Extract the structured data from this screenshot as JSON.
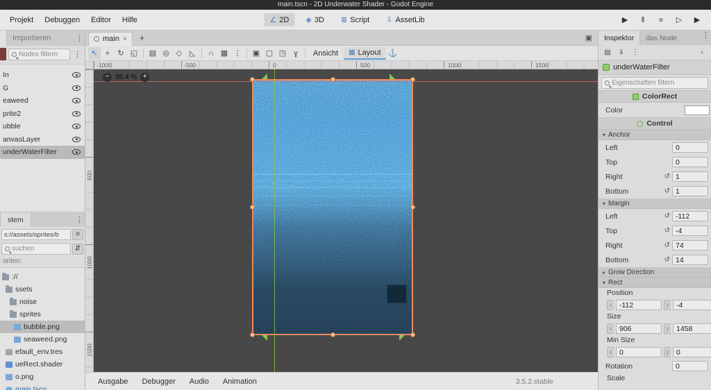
{
  "window": {
    "title": "main.tscn - 2D Underwater Shader - Godot Engine"
  },
  "menubar": {
    "menus": [
      "Projekt",
      "Debuggen",
      "Editor",
      "Hilfe"
    ],
    "workspaces": [
      "2D",
      "3D",
      "Script",
      "AssetLib"
    ]
  },
  "scene_dock": {
    "import_tab": "Importieren",
    "filter_placeholder": "Nodes filtern",
    "nodes": [
      {
        "label": "In"
      },
      {
        "label": "G"
      },
      {
        "label": "eaweed"
      },
      {
        "label": "prite2"
      },
      {
        "label": "ubble"
      },
      {
        "label": "anvasLayer"
      },
      {
        "label": "underWaterFilter"
      }
    ]
  },
  "filesystem_dock": {
    "tab": "stem",
    "path": "s://assets/sprites/b",
    "search_placeholder": "suchen",
    "favorites_label": "oriten:",
    "items": [
      {
        "label": "://"
      },
      {
        "label": "ssets"
      },
      {
        "label": "noise"
      },
      {
        "label": "sprites"
      },
      {
        "label": "bubble.png"
      },
      {
        "label": "seaweed.png"
      },
      {
        "label": "efault_env.tres"
      },
      {
        "label": "ueRect.shader"
      },
      {
        "label": "o.png"
      },
      {
        "label": "main.tsco"
      }
    ]
  },
  "scene_tabs": {
    "main_tab": "main"
  },
  "canvas_toolbar": {
    "view_label": "Ansicht",
    "layout_label": "Layout"
  },
  "viewport": {
    "zoom": "35.4 %",
    "ruler_top": [
      "-1000",
      "-500",
      "0",
      "500",
      "1000",
      "1500"
    ],
    "ruler_left": [
      "500",
      "1000",
      "1500"
    ]
  },
  "inspector": {
    "tabs": [
      "Inspektor",
      "das Node"
    ],
    "node_name": "underWaterFilter",
    "filter_placeholder": "Eigenschaften filtern",
    "category_colorrect": "ColorRect",
    "color_label": "Color",
    "category_control": "Control",
    "anchor": {
      "title": "Anchor",
      "rows": [
        {
          "label": "Left",
          "value": "0"
        },
        {
          "label": "Top",
          "value": "0"
        },
        {
          "label": "Right",
          "value": "1"
        },
        {
          "label": "Bottom",
          "value": "1"
        }
      ]
    },
    "margin": {
      "title": "Margin",
      "rows": [
        {
          "label": "Left",
          "value": "-112"
        },
        {
          "label": "Top",
          "value": "-4"
        },
        {
          "label": "Right",
          "value": "74"
        },
        {
          "label": "Bottom",
          "value": "14"
        }
      ]
    },
    "grow_direction_title": "Grow Direction",
    "rect": {
      "title": "Rect",
      "position_label": "Position",
      "position": [
        "-112",
        "-4"
      ],
      "size_label": "Size",
      "size": [
        "906",
        "1458"
      ],
      "min_size_label": "Min Size",
      "min_size": [
        "0",
        "0"
      ],
      "rotation_label": "Rotation",
      "rotation": "0",
      "scale_label": "Scale"
    },
    "axis_tags": [
      "x",
      "y"
    ]
  },
  "bottom_bar": {
    "buttons": [
      "Ausgabe",
      "Debugger",
      "Audio",
      "Animation"
    ],
    "version": "3.5.2.stable"
  },
  "colors": {
    "selection_orange": "#ee8a5f",
    "anchor_green": "#86c556",
    "axis_green": "#8dc63f",
    "guide_pink": "#d96a6a",
    "current_scene_blue": "#2f66a3"
  },
  "icons": {
    "play": "▶",
    "pause": "‖",
    "stop": "■",
    "play_scene": "▷",
    "play_custom": "▶",
    "ws_2d": "∠",
    "ws_3d": "◈",
    "ws_script": "≣",
    "ws_assetlib": "⇩",
    "select": "↖",
    "move": "+",
    "rotate": "↻",
    "scale": "◱",
    "list_select": "▤",
    "pivot": "◎",
    "pan": "◇",
    "ruler": "◺",
    "smart_snap": "∩",
    "grid_snap": "▦",
    "snap_opts": "⋮",
    "lock": "▣",
    "unlock": "▢",
    "group": "◳",
    "skeleton": "ɣ",
    "anchor_menu": "⚓",
    "dots": "⋮",
    "close": "×",
    "plus": "+",
    "expand": "▣",
    "sort": "⇵",
    "copy_path": "≡",
    "revert": "↺",
    "back": "‹",
    "res_new": "▤",
    "res_load": "⇓",
    "open": "▾",
    "closed": "▸",
    "minus": "−",
    "layout_grid": "▦",
    "scene_circle": "",
    "zoom_out": "−",
    "zoom_in": "+"
  }
}
